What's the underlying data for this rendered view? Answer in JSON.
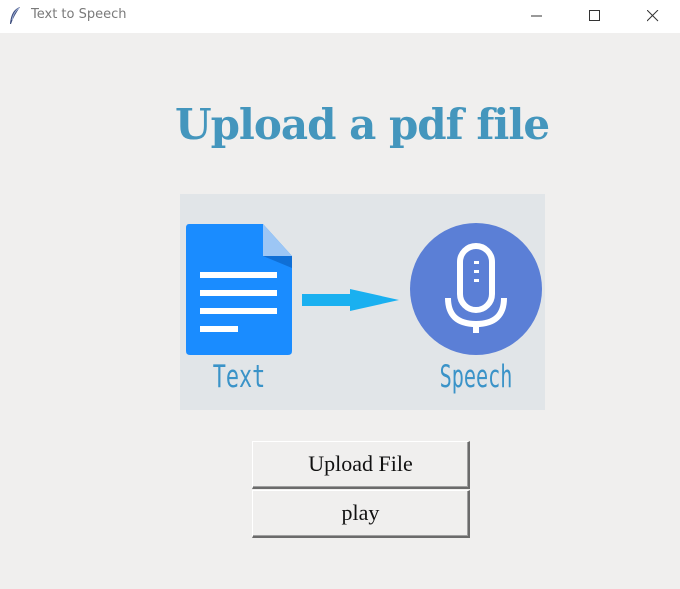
{
  "window": {
    "title": "Text to Speech",
    "icon": "feather-icon",
    "controls": [
      "minimize-icon",
      "maximize-icon",
      "close-icon"
    ]
  },
  "main": {
    "heading": "Upload a pdf file",
    "illustration": {
      "left_label": "Text",
      "right_label": "Speech",
      "icons": [
        "document-icon",
        "arrow-right-icon",
        "microphone-icon"
      ]
    },
    "buttons": {
      "upload_label": "Upload File",
      "play_label": "play"
    }
  },
  "colors": {
    "background": "#f0efee",
    "heading": "#4496bd",
    "document": "#1a8cff",
    "arrow": "#1ab0f0",
    "mic_circle": "#5b7fd6",
    "label": "#3a93c8"
  }
}
